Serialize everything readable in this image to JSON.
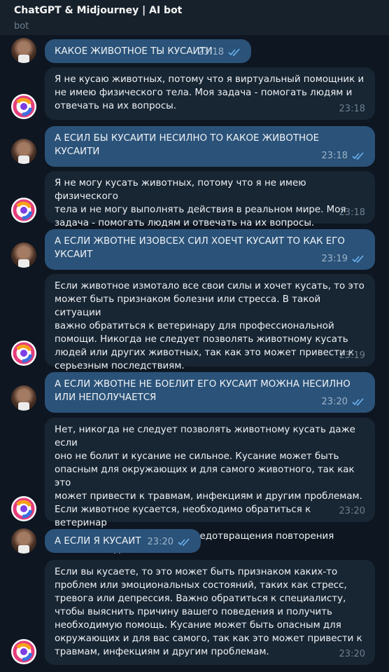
{
  "header": {
    "title": "ChatGPT & Midjourney | AI bot",
    "subtitle": "bot"
  },
  "messages": [
    {
      "text": "КАКОЕ ЖИВОТНОЕ ТЫ КУСАИТИ",
      "time": "23:18"
    },
    {
      "text": "Я не кусаю животных, потому что я виртуальный помощник и\nне имею физического тела. Моя задача - помогать людям и\nотвечать на их вопросы.",
      "time": "23:18"
    },
    {
      "text": "А ЕСИЛ БЫ КУСАИТИ НЕСИЛНО ТО КАКОЕ ЖИВОТНОЕ\nКУСАИТИ",
      "time": "23:18"
    },
    {
      "text": "Я не могу кусать животных, потому что я не имею физического\nтела и не могу выполнять действия в реальном мире. Моя\nзадача - помогать людям и отвечать на их вопросы.",
      "time": "23:18"
    },
    {
      "text": "А ЕСЛИ ЖВОТНЕ ИЗОВСЕХ СИЛ ХОЕЧТ КУСАИТ ТО КАК ЕГО\nУКСАИТ",
      "time": "23:19"
    },
    {
      "text": "Если животное измотало все свои силы и хочет кусать, то это\nможет быть признаком болезни или стресса. В такой ситуации\nважно обратиться к ветеринару для профессиональной\nпомощи. Никогда не следует позволять животному кусать\nлюдей или других животных, так как это может привести к\nсерьезным последствиям.",
      "time": "23:19"
    },
    {
      "text": "А ЕСЛИ ЖВОТНЕ НЕ БОЕЛИТ ЕГО КУСАИТ МОЖНА НЕСИЛНО\nИЛИ НЕПОЛУЧАЕТСЯ",
      "time": "23:20"
    },
    {
      "text": "Нет, никогда не следует позволять животному кусать даже если\nоно не болит и кусание не сильное. Кусание может быть\nопасным для окружающих и для самого животного, так как это\nможет привести к травмам, инфекциям и другим проблемам.\nЕсли животное кусается, необходимо обратиться к ветеринар\nдля выявления причины и предотвращения повторения\nтакого поведения.",
      "time": "23:20"
    },
    {
      "text": "А ЕСЛИ Я КУСАИТ",
      "time": "23:20"
    },
    {
      "text": "Если вы кусаете, то это может быть признаком каких-то\nпроблем или эмоциональных состояний, таких как стресс,\nтревога или депрессия. Важно обратиться к специалисту,\nчтобы выяснить причину вашего поведения и получить\nнеобходимую помощь. Кусание может быть опасным для\nокружающих и для вас самого, так как это может привести к\nтравмам, инфекциям и другим проблемам.",
      "time": "23:20"
    }
  ]
}
